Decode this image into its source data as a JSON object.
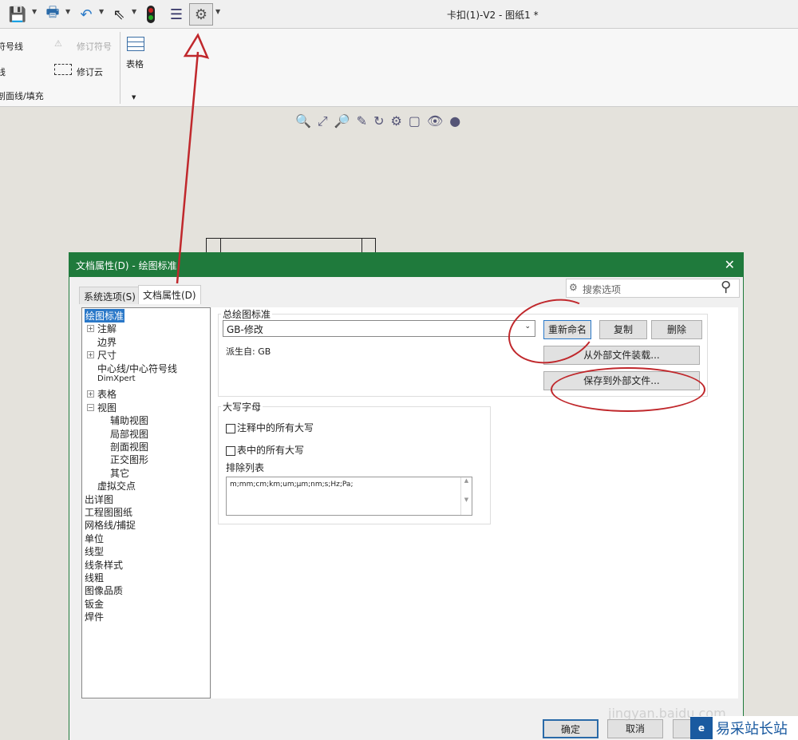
{
  "window_title": "卡扣(1)-V2 - 图纸1 *",
  "toolbar": {
    "icons": [
      "save-icon",
      "print-icon",
      "undo-icon",
      "select-icon",
      "rebuild-icon",
      "file-properties-icon",
      "options-icon"
    ]
  },
  "ribbon": {
    "items": [
      "符号线",
      "线",
      "剖面线/填充",
      "修订符号",
      "修订云",
      "表格"
    ]
  },
  "dialog": {
    "title": "文档属性(D) - 绘图标准",
    "tabs": [
      "系统选项(S)",
      "文档属性(D)"
    ],
    "search_placeholder": "搜索选项",
    "tree": [
      "绘图标准",
      "注解",
      "边界",
      "尺寸",
      "中心线/中心符号线",
      "DimXpert",
      "表格",
      "视图",
      "辅助视图",
      "局部视图",
      "剖面视图",
      "正交图形",
      "其它",
      "虚拟交点",
      "出详图",
      "工程图图纸",
      "网格线/捕捉",
      "单位",
      "线型",
      "线条样式",
      "线粗",
      "图像品质",
      "钣金",
      "焊件"
    ],
    "overall_standard": {
      "label": "总绘图标准",
      "value": "GB-修改",
      "derived": "派生自: GB",
      "rename": "重新命名",
      "copy": "复制",
      "delete": "删除",
      "load": "从外部文件装载...",
      "save": "保存到外部文件..."
    },
    "uppercase": {
      "label": "大写字母",
      "opt1": "注释中的所有大写",
      "opt2": "表中的所有大写",
      "exclude_label": "排除列表",
      "exclude_value": "m;mm;cm;km;um;µm;nm;s;Hz;Pa;"
    },
    "ok": "确定",
    "cancel": "取消"
  },
  "watermark": {
    "text": "易采站长站",
    "url": "jingyan.baidu.com"
  }
}
